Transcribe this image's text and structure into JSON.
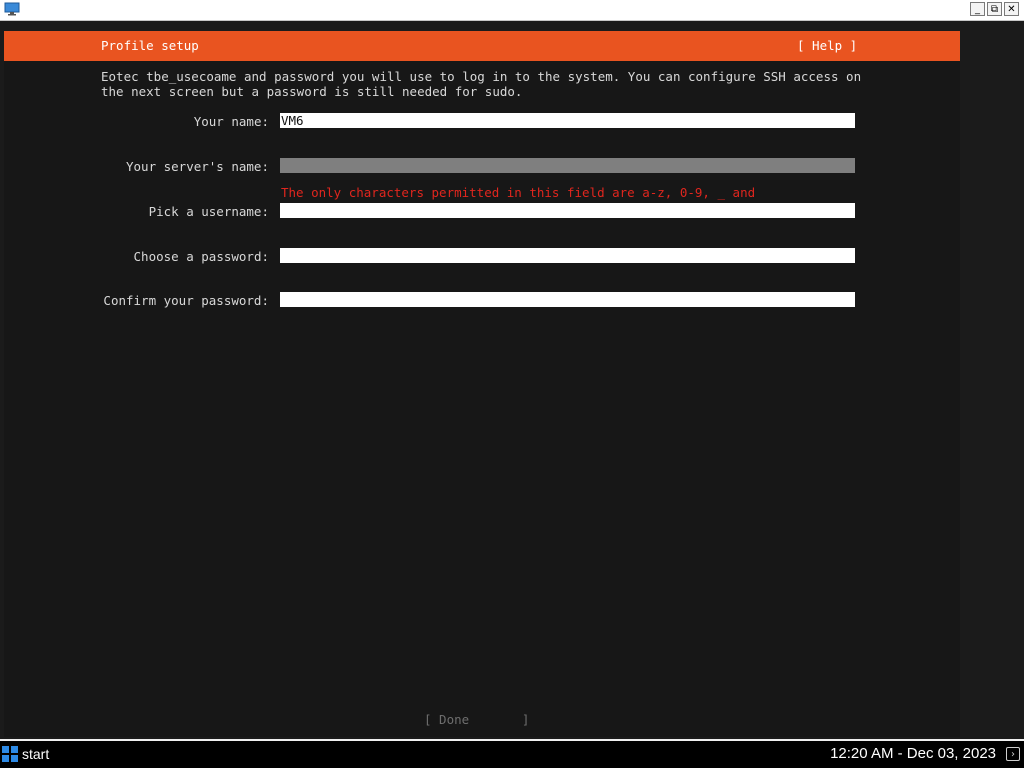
{
  "window": {
    "app_icon": "monitor-icon",
    "controls": {
      "minimize": "_",
      "restore": "⧉",
      "close": "✕"
    }
  },
  "installer": {
    "header_title": "Profile setup",
    "help_label": "[ Help ]",
    "intro_text": "Eotec tbe_usecoame and password you will use to log in to the system. You can configure SSH access on\nthe next screen but a password is still needed for sudo.",
    "fields": [
      {
        "label": "Your name:",
        "value": "VM6"
      },
      {
        "label": "Your server's name:",
        "value": ""
      },
      {
        "label": "Pick a username:",
        "value": ""
      },
      {
        "label": "Choose a password:",
        "value": ""
      },
      {
        "label": "Confirm your password:",
        "value": ""
      }
    ],
    "server_name_error": "The only characters permitted in this field are a-z, 0-9, _ and",
    "done_label": "[ Done       ]"
  },
  "colors": {
    "accent": "#e95420",
    "error": "#e0261e",
    "background": "#171717"
  },
  "taskbar": {
    "start_icon": "windows-logo-icon",
    "start_label": "start",
    "clock": "12:20 AM - Dec 03, 2023",
    "tray_icon": "chevron-icon"
  }
}
